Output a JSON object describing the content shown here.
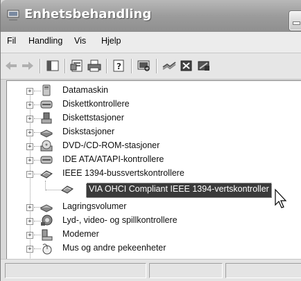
{
  "window": {
    "title": "Enhetsbehandling"
  },
  "menu": {
    "items": [
      "Fil",
      "Handling",
      "Vis",
      "Hjelp"
    ]
  },
  "toolbar": {
    "buttons": [
      "back-arrow-icon",
      "forward-arrow-icon",
      "console-tree-icon",
      "properties-icon",
      "print-icon",
      "help-icon",
      "scan-hardware-icon",
      "update-driver-icon",
      "uninstall-icon",
      "disable-icon"
    ]
  },
  "tree": {
    "items": [
      {
        "label": "Datamaskin",
        "expander": "+",
        "icon": "computer-icon"
      },
      {
        "label": "Diskettkontrollere",
        "expander": "+",
        "icon": "floppy-controller-icon"
      },
      {
        "label": "Diskettstasjoner",
        "expander": "+",
        "icon": "floppy-drive-icon"
      },
      {
        "label": "Diskstasjoner",
        "expander": "+",
        "icon": "disk-drive-icon"
      },
      {
        "label": "DVD-/CD-ROM-stasjoner",
        "expander": "+",
        "icon": "cd-rom-icon"
      },
      {
        "label": "IDE ATA/ATAPI-kontrollere",
        "expander": "+",
        "icon": "ide-controller-icon"
      },
      {
        "label": "IEEE 1394-bussvertskontrollere",
        "expander": "−",
        "icon": "ieee1394-icon"
      },
      {
        "label": "Lagringsvolumer",
        "expander": "+",
        "icon": "storage-volume-icon"
      },
      {
        "label": "Lyd-, video- og spillkontrollere",
        "expander": "+",
        "icon": "sound-icon"
      },
      {
        "label": "Modemer",
        "expander": "+",
        "icon": "modem-icon"
      },
      {
        "label": "Mus og andre pekeenheter",
        "expander": "+",
        "icon": "mouse-icon"
      }
    ],
    "child": {
      "label": "VIA OHCI Compliant IEEE 1394-vertskontroller",
      "icon": "ieee1394-device-icon"
    }
  }
}
